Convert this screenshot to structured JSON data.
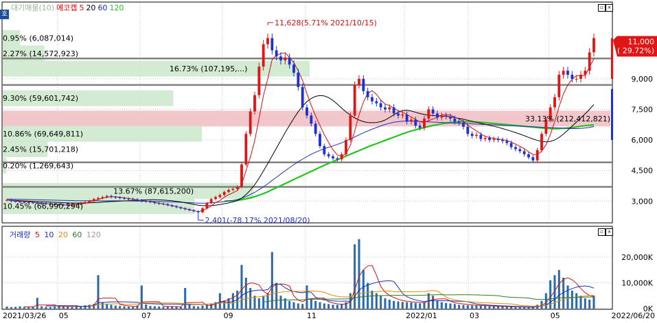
{
  "legend": {
    "title": "대기매물(10)",
    "stock": "에코캡",
    "ma": [
      {
        "label": "5",
        "color": "#d01010"
      },
      {
        "label": "20",
        "color": "#000000"
      },
      {
        "label": "60",
        "color": "#1a2fb8"
      },
      {
        "label": "120",
        "color": "#22c51a"
      }
    ]
  },
  "volume_legend": {
    "title": "거래량",
    "ma": [
      {
        "label": "5",
        "color": "#d01010"
      },
      {
        "label": "10",
        "color": "#1a2fb8"
      },
      {
        "label": "20",
        "color": "#e08a00"
      },
      {
        "label": "60",
        "color": "#2a7a2a"
      },
      {
        "label": "120",
        "color": "#9a9a9a"
      }
    ]
  },
  "side_tab": "호",
  "colors": {
    "up": "#e01515",
    "down": "#1f2fd0",
    "supply_band": "#cde9cd",
    "current_band": "#f2c7cc",
    "grid": "#b0b0b0",
    "hline": "#808080"
  },
  "chart_data": {
    "type": "candlestick",
    "price_axis": {
      "ticks": [
        "9,000",
        "7,500",
        "6,000",
        "4,500",
        "3,000"
      ],
      "tick_values": [
        9000,
        7500,
        6000,
        4500,
        3000
      ],
      "ylim": [
        2100,
        12600
      ]
    },
    "volume_axis": {
      "ticks": [
        "20,000K",
        "10,000K",
        "0K"
      ],
      "tick_values": [
        20000,
        10000,
        0
      ],
      "ylim": [
        0,
        28000
      ]
    },
    "x_labels": [
      "2021/03/26",
      "05",
      "07",
      "09",
      "11",
      "2022/01",
      "03",
      "05",
      "2022/06/20"
    ],
    "current_price": {
      "price": "11,000",
      "change": "( 29.72%)",
      "value": 11000
    },
    "high_annotation": {
      "text": "11,628(5.71% 2021/10/15)",
      "value": 11628
    },
    "low_annotation": {
      "text": "2,401(-78.17% 2021/08/20)",
      "value": 2401
    },
    "supply_levels": [
      {
        "text": "0.95% (6,087,014)",
        "price": 11000,
        "pct": 0.95,
        "shares": 6087014,
        "current": false
      },
      {
        "text": "2.27% (14,572,923)",
        "price": 10250,
        "pct": 2.27,
        "shares": 14572923,
        "current": false
      },
      {
        "text": "16.73% (107,195,...)",
        "price": 9500,
        "pct": 16.73,
        "shares": 107195000,
        "current": false
      },
      {
        "text": "9.30% (59,601,742)",
        "price": 8050,
        "pct": 9.3,
        "shares": 59601742,
        "current": false
      },
      {
        "text": "33.13% (212,412,821)",
        "price": 7050,
        "pct": 33.13,
        "shares": 212412821,
        "current": true
      },
      {
        "text": "10.86% (69,649,811)",
        "price": 6300,
        "pct": 10.86,
        "shares": 69649811,
        "current": false
      },
      {
        "text": "2.45% (15,701,218)",
        "price": 5550,
        "pct": 2.45,
        "shares": 15701218,
        "current": false
      },
      {
        "text": "0.20% (1,269,643)",
        "price": 4750,
        "pct": 0.2,
        "shares": 1269643,
        "current": false
      },
      {
        "text": "13.67% (87,615,200)",
        "price": 3500,
        "pct": 13.67,
        "shares": 87615200,
        "current": false
      },
      {
        "text": "10.45% (66,990,294)",
        "price": 2750,
        "pct": 10.45,
        "shares": 66990294,
        "current": false
      }
    ],
    "horizontal_lines": [
      10000,
      8700,
      4900,
      3700
    ],
    "close_series": [
      3050,
      3000,
      2980,
      2960,
      2950,
      2930,
      2920,
      2900,
      2890,
      2870,
      2850,
      2830,
      2820,
      2800,
      2790,
      2800,
      2850,
      2900,
      2950,
      3000,
      3100,
      3150,
      3200,
      3250,
      3200,
      3180,
      3150,
      3120,
      3100,
      3080,
      3050,
      3000,
      2980,
      2950,
      2900,
      2870,
      2850,
      2800,
      2750,
      2700,
      2650,
      2600,
      2550,
      2500,
      2450,
      2650,
      2900,
      3100,
      3200,
      3300,
      3450,
      3550,
      3600,
      3700,
      4800,
      6300,
      7400,
      8200,
      9600,
      10700,
      11000,
      10400,
      10100,
      9900,
      10050,
      9700,
      9300,
      8600,
      7600,
      7200,
      6800,
      6300,
      5700,
      5300,
      5200,
      5100,
      5050,
      5300,
      6000,
      7200,
      8700,
      9000,
      8400,
      8100,
      7900,
      7800,
      7600,
      7500,
      7600,
      7300,
      7200,
      7250,
      6900,
      7000,
      6700,
      6600,
      7050,
      7500,
      7300,
      7100,
      7200,
      7150,
      7050,
      6900,
      6850,
      6650,
      6300,
      6200,
      6250,
      6050,
      6100,
      6000,
      6050,
      6000,
      5950,
      5850,
      5650,
      5550,
      5450,
      5300,
      5150,
      5000,
      5500,
      6300,
      7000,
      7600,
      8100,
      9200,
      9400,
      9200,
      9000,
      9000,
      9200,
      9400,
      10300,
      11000
    ],
    "ma5": [
      3050,
      3020,
      3000,
      2990,
      2980,
      2960,
      2940,
      2920,
      2905,
      2885,
      2866,
      2848,
      2832,
      2816,
      2804,
      2806,
      2826,
      2856,
      2898,
      2950,
      3020,
      3080,
      3140,
      3190,
      3220,
      3210,
      3190,
      3160,
      3130,
      3100,
      3070,
      3035,
      3000,
      2970,
      2930,
      2895,
      2860,
      2820,
      2780,
      2730,
      2680,
      2630,
      2580,
      2530,
      2480,
      2540,
      2630,
      2760,
      2930,
      3030,
      3190,
      3310,
      3410,
      3520,
      3820,
      4490,
      5170,
      5970,
      7060,
      8180,
      9000,
      9940,
      10160,
      10240,
      10280,
      10050,
      9800,
      9400,
      8920,
      8280,
      7700,
      7180,
      6720,
      6260,
      5880,
      5520,
      5270,
      5190,
      5330,
      5730,
      6440,
      7240,
      7860,
      8300,
      8420,
      8240,
      7960,
      7760,
      7690,
      7560,
      7440,
      7370,
      7250,
      7130,
      7010,
      6890,
      6870,
      6950,
      7030,
      7110,
      7230,
      7240,
      7220,
      7120,
      7030,
      6920,
      6730,
      6580,
      6450,
      6290,
      6180,
      6120,
      6080,
      6040,
      6020,
      5970,
      5890,
      5800,
      5690,
      5570,
      5420,
      5290,
      5280,
      5450,
      5760,
      6280,
      6900,
      7640,
      8260,
      8700,
      8980,
      9160,
      9160,
      9160,
      9580,
      9980
    ],
    "ma20": [
      3050,
      3040,
      3030,
      3020,
      3010,
      3000,
      2990,
      2980,
      2970,
      2960,
      2950,
      2940,
      2930,
      2920,
      2910,
      2905,
      2905,
      2905,
      2910,
      2915,
      2925,
      2935,
      2950,
      2965,
      2980,
      2990,
      3000,
      3010,
      3020,
      3030,
      3040,
      3050,
      3060,
      3065,
      3065,
      3060,
      3050,
      3035,
      3015,
      2990,
      2960,
      2920,
      2880,
      2840,
      2800,
      2780,
      2770,
      2780,
      2800,
      2830,
      2870,
      2910,
      2960,
      3020,
      3140,
      3320,
      3540,
      3800,
      4120,
      4480,
      4840,
      5220,
      5600,
      5980,
      6360,
      6720,
      7060,
      7380,
      7660,
      7880,
      8040,
      8140,
      8180,
      8160,
      8080,
      7940,
      7760,
      7560,
      7380,
      7220,
      7080,
      6980,
      6900,
      6860,
      6850,
      6860,
      6900,
      6980,
      7100,
      7240,
      7360,
      7440,
      7460,
      7420,
      7360,
      7300,
      7250,
      7220,
      7200,
      7190,
      7180,
      7160,
      7130,
      7100,
      7060,
      7020,
      6970,
      6920,
      6870,
      6820,
      6770,
      6720,
      6670,
      6620,
      6560,
      6500,
      6430,
      6360,
      6290,
      6210,
      6130,
      6050,
      5980,
      5930,
      5910,
      5930,
      6000,
      6120,
      6290,
      6480,
      6680,
      6880,
      7080,
      7280,
      7500,
      7740
    ],
    "ma60": [
      3100,
      3095,
      3090,
      3085,
      3080,
      3075,
      3070,
      3065,
      3060,
      3055,
      3050,
      3045,
      3040,
      3035,
      3030,
      3025,
      3020,
      3018,
      3016,
      3015,
      3014,
      3013,
      3012,
      3012,
      3012,
      3012,
      3011,
      3010,
      3008,
      3005,
      3002,
      2998,
      2994,
      2990,
      2985,
      2980,
      2975,
      2968,
      2960,
      2950,
      2940,
      2930,
      2920,
      2910,
      2900,
      2900,
      2905,
      2915,
      2930,
      2950,
      2975,
      3005,
      3040,
      3080,
      3140,
      3220,
      3320,
      3430,
      3560,
      3700,
      3850,
      4010,
      4170,
      4330,
      4490,
      4640,
      4790,
      4930,
      5060,
      5180,
      5300,
      5400,
      5490,
      5570,
      5640,
      5710,
      5780,
      5860,
      5950,
      6050,
      6150,
      6250,
      6350,
      6440,
      6530,
      6610,
      6690,
      6760,
      6820,
      6870,
      6900,
      6920,
      6930,
      6930,
      6920,
      6910,
      6900,
      6890,
      6880,
      6870,
      6860,
      6850,
      6840,
      6830,
      6820,
      6810,
      6800,
      6790,
      6780,
      6770,
      6760,
      6750,
      6740,
      6730,
      6720,
      6710,
      6700,
      6690,
      6680,
      6670,
      6660,
      6650,
      6640,
      6630,
      6620,
      6610,
      6600,
      6590,
      6580,
      6570,
      6560,
      6560,
      6570,
      6590,
      6620,
      6660
    ],
    "ma120": [
      null,
      null,
      null,
      null,
      null,
      null,
      null,
      null,
      null,
      null,
      null,
      null,
      null,
      null,
      null,
      null,
      null,
      null,
      null,
      null,
      null,
      null,
      null,
      null,
      null,
      null,
      null,
      null,
      null,
      null,
      null,
      null,
      null,
      null,
      null,
      null,
      null,
      null,
      null,
      null,
      null,
      null,
      null,
      null,
      null,
      null,
      null,
      null,
      null,
      null,
      3000,
      3010,
      3020,
      3040,
      3070,
      3110,
      3160,
      3220,
      3290,
      3370,
      3460,
      3560,
      3660,
      3760,
      3860,
      3960,
      4060,
      4160,
      4260,
      4360,
      4460,
      4560,
      4660,
      4760,
      4850,
      4940,
      5030,
      5120,
      5210,
      5300,
      5390,
      5480,
      5570,
      5660,
      5740,
      5820,
      5900,
      5980,
      6060,
      6140,
      6220,
      6300,
      6370,
      6440,
      6500,
      6560,
      6610,
      6660,
      6710,
      6750,
      6790,
      6830,
      6860,
      6880,
      6900,
      6900,
      6900,
      6890,
      6880,
      6870,
      6850,
      6830,
      6810,
      6790,
      6770,
      6750,
      6730,
      6710,
      6690,
      6670,
      6650,
      6630,
      6610,
      6590,
      6570,
      6560,
      6550,
      6560,
      6570,
      6590,
      6610,
      6640,
      6670,
      6700,
      6720,
      6740
    ],
    "volume": [
      800,
      600,
      700,
      900,
      650,
      500,
      700,
      4200,
      900,
      700,
      600,
      800,
      1200,
      900,
      700,
      600,
      800,
      1000,
      1300,
      1500,
      1800,
      13000,
      2500,
      1800,
      1500,
      1200,
      1000,
      900,
      800,
      700,
      1200,
      9000,
      1600,
      1000,
      900,
      800,
      700,
      800,
      900,
      700,
      600,
      8000,
      1500,
      1000,
      800,
      1200,
      1500,
      2000,
      2500,
      6000,
      3000,
      4000,
      6000,
      7000,
      17000,
      12000,
      8000,
      5000,
      4000,
      5000,
      6000,
      22000,
      10000,
      5000,
      4000,
      3000,
      2500,
      2000,
      1800,
      9000,
      4000,
      3000,
      2500,
      2000,
      1800,
      1500,
      1500,
      1800,
      2500,
      6000,
      25000,
      27000,
      15000,
      10000,
      7000,
      6000,
      5000,
      4000,
      3500,
      3000,
      2800,
      2600,
      2500,
      2400,
      2200,
      2000,
      2500,
      6000,
      5000,
      3000,
      2500,
      2200,
      2000,
      1800,
      1500,
      1400,
      1300,
      1200,
      1200,
      1100,
      1000,
      900,
      900,
      800,
      800,
      700,
      700,
      600,
      600,
      500,
      500,
      500,
      1500,
      3000,
      6000,
      11000,
      13000,
      15000,
      12000,
      9000,
      7000,
      6000,
      5000,
      4000,
      3500,
      5000
    ]
  }
}
